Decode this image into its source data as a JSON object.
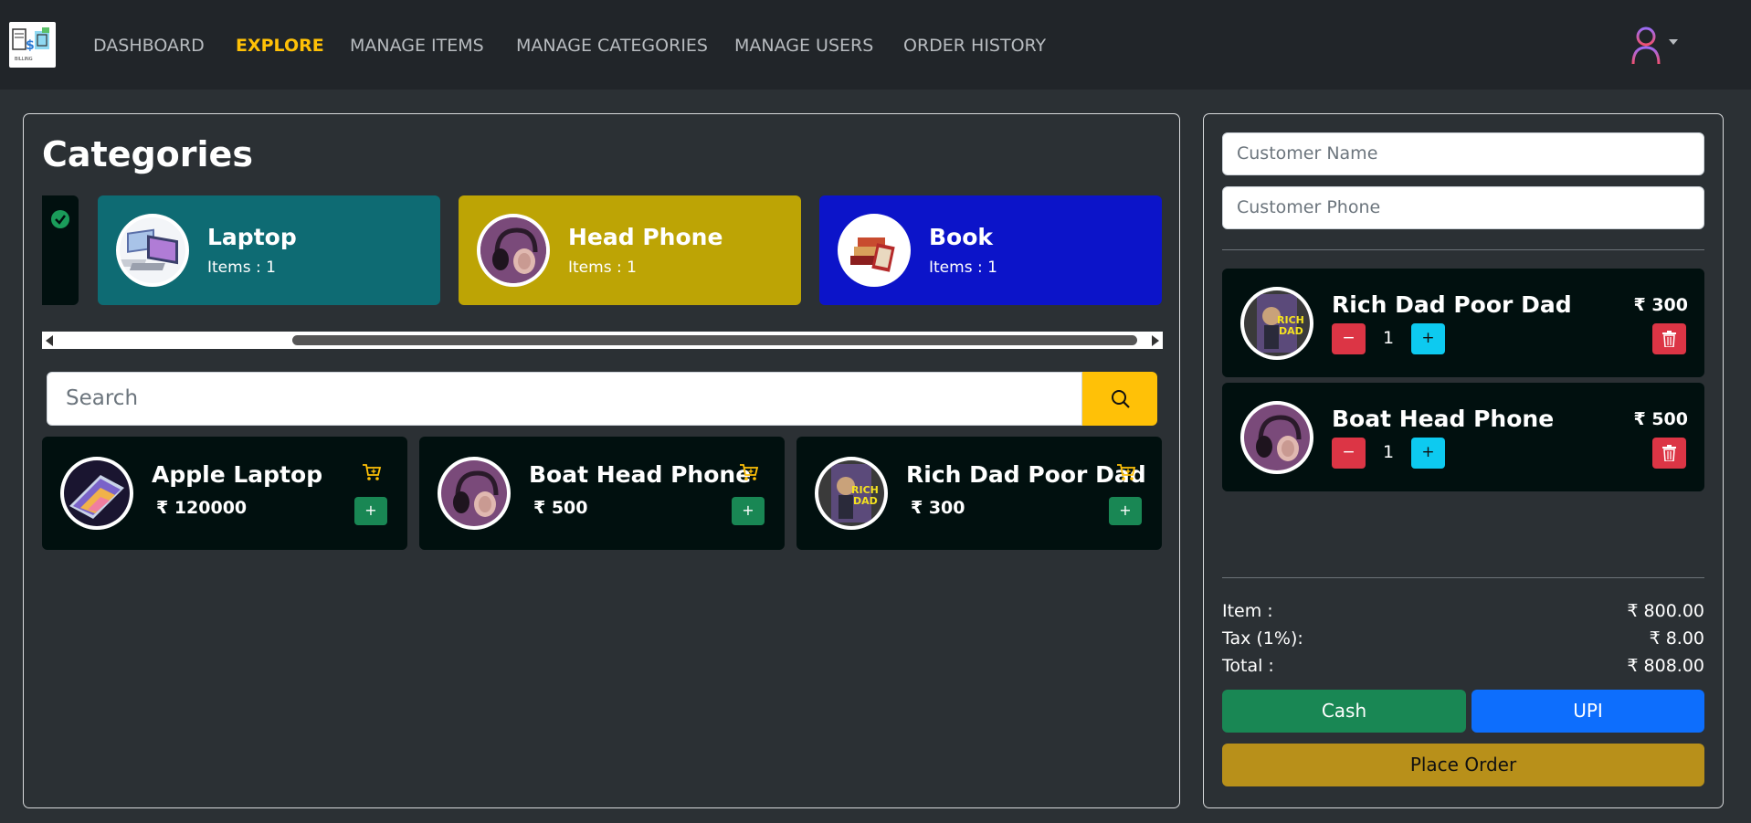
{
  "navbar": {
    "items": [
      {
        "label": "DASHBOARD",
        "active": false
      },
      {
        "label": "EXPLORE",
        "active": true
      },
      {
        "label": "MANAGE ITEMS",
        "active": false
      },
      {
        "label": "MANAGE CATEGORIES",
        "active": false
      },
      {
        "label": "MANAGE USERS",
        "active": false
      },
      {
        "label": "ORDER HISTORY",
        "active": false
      }
    ],
    "user_icon": "user-icon",
    "accent_color": "#ffc107"
  },
  "categories": {
    "title": "Categories",
    "items": [
      {
        "name": "Laptop",
        "count": "Items : 1",
        "color": "#0e6b73",
        "icon": "laptop-image"
      },
      {
        "name": "Head Phone",
        "count": "Items : 1",
        "color": "#bda405",
        "icon": "headphone-image"
      },
      {
        "name": "Book",
        "count": "Items : 1",
        "color": "#0c14c9",
        "icon": "book-image"
      }
    ]
  },
  "search": {
    "placeholder": "Search"
  },
  "items": [
    {
      "name": "Apple Laptop",
      "price": "₹ 120000",
      "icon": "laptop-image",
      "add_label": "+"
    },
    {
      "name": "Boat Head Phone",
      "price": "₹ 500",
      "icon": "headphone-image",
      "add_label": "+"
    },
    {
      "name": "Rich Dad Poor Dad",
      "price": "₹ 300",
      "icon": "book-cover-image",
      "add_label": "+"
    }
  ],
  "customer": {
    "name_placeholder": "Customer Name",
    "phone_placeholder": "Customer Phone"
  },
  "cart": {
    "items": [
      {
        "name": "Rich Dad Poor Dad",
        "price": "₹ 300",
        "qty": "1",
        "minus_label": "−",
        "plus_label": "+"
      },
      {
        "name": "Boat Head Phone",
        "price": "₹ 500",
        "qty": "1",
        "minus_label": "−",
        "plus_label": "+"
      }
    ]
  },
  "summary": {
    "item_label": "Item :",
    "item_value": "₹ 800.00",
    "tax_label": "Tax (1%):",
    "tax_value": "₹ 8.00",
    "total_label": "Total :",
    "total_value": "₹ 808.00"
  },
  "actions": {
    "cash_label": "Cash",
    "upi_label": "UPI",
    "place_order_label": "Place Order",
    "cash_color": "#198754",
    "upi_color": "#0d6efd",
    "place_color": "#b8901a"
  }
}
